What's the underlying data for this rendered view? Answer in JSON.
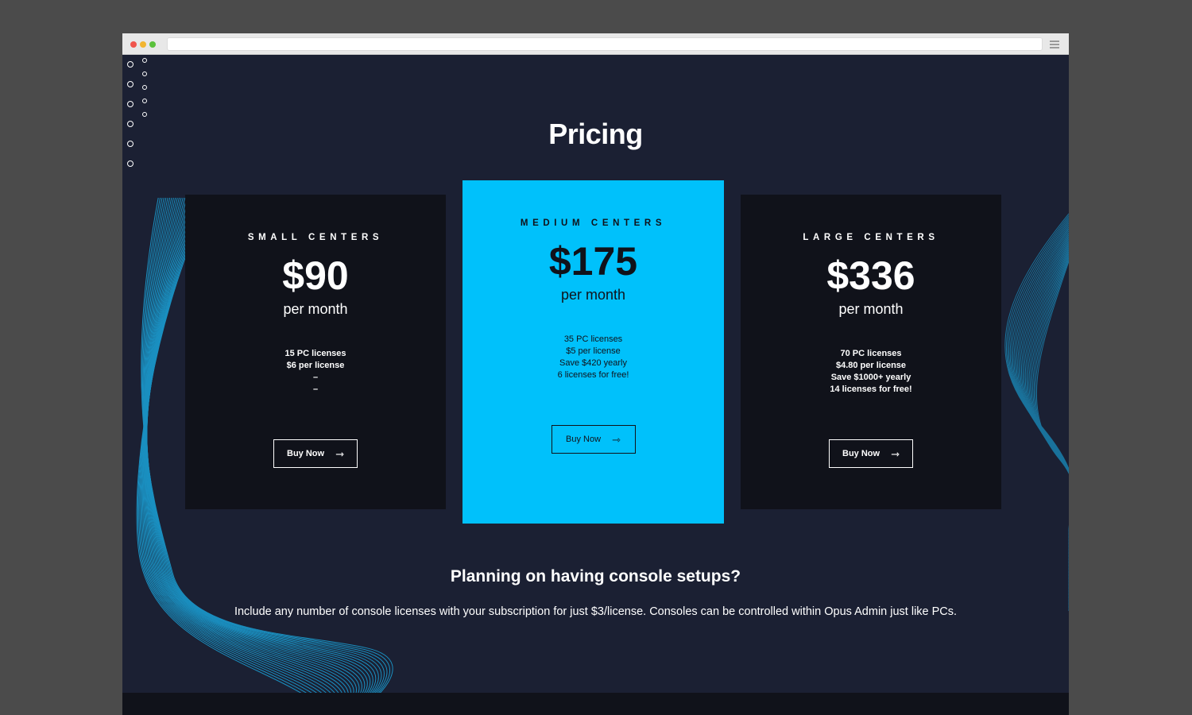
{
  "colors": {
    "page_bg": "#1b2033",
    "card_dark": "#10121a",
    "card_featured": "#00c1fb",
    "wave": "#1ab5f0",
    "text_light": "#ffffff"
  },
  "page": {
    "title": "Pricing"
  },
  "plans": [
    {
      "label": "SMALL CENTERS",
      "price": "$90",
      "period": "per month",
      "features": [
        "15 PC licenses",
        "$6 per license",
        "–",
        "–"
      ],
      "button": "Buy Now",
      "button_icon": "arrow-right-icon"
    },
    {
      "label": "MEDIUM CENTERS",
      "price": "$175",
      "period": "per month",
      "features": [
        "35 PC licenses",
        "$5 per license",
        "Save $420 yearly",
        "6 licenses for free!"
      ],
      "button": "Buy Now",
      "button_icon": "arrow-right-icon"
    },
    {
      "label": "LARGE CENTERS",
      "price": "$336",
      "period": "per month",
      "features": [
        "70 PC licenses",
        "$4.80 per license",
        "Save $1000+ yearly",
        "14 licenses for free!"
      ],
      "button": "Buy Now",
      "button_icon": "arrow-right-icon"
    }
  ],
  "console": {
    "heading": "Planning on having console setups?",
    "text": "Include any number of console licenses with your subscription for just $3/license. Consoles can be controlled within Opus Admin just like PCs."
  }
}
